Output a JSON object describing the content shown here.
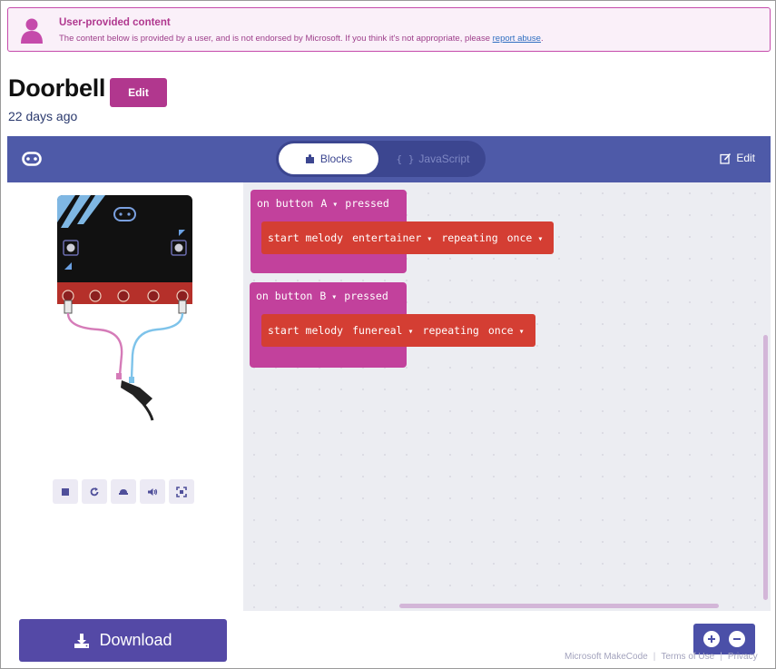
{
  "notice": {
    "title": "User-provided content",
    "body": "The content below is provided by a user, and is not endorsed by Microsoft. If you think it's not appropriate, please ",
    "link": "report abuse",
    "end": "."
  },
  "project": {
    "title": "Doorbell",
    "edit_label": "Edit",
    "subtitle": "22 days ago"
  },
  "editor_bar": {
    "tabs": [
      {
        "label": "Blocks",
        "active": true
      },
      {
        "label": "JavaScript",
        "active": false
      }
    ],
    "edit_label": "Edit"
  },
  "blocks": [
    {
      "event": {
        "prefix": "on button",
        "button": "A",
        "suffix": "pressed"
      },
      "statement": {
        "keyword": "start melody",
        "melody": "entertainer",
        "repeat_label": "repeating",
        "repeat_value": "once"
      }
    },
    {
      "event": {
        "prefix": "on button",
        "button": "B",
        "suffix": "pressed"
      },
      "statement": {
        "keyword": "start melody",
        "melody": "funereal",
        "repeat_label": "repeating",
        "repeat_value": "once"
      }
    }
  ],
  "simulator_controls": [
    "stop-icon",
    "restart-icon",
    "slow-motion-icon",
    "mute-icon",
    "fullscreen-icon"
  ],
  "download_label": "Download",
  "footer": {
    "brand": "Microsoft MakeCode",
    "terms": "Terms of Use",
    "privacy": "Privacy"
  },
  "colors": {
    "accent": "#b1378e",
    "toolbar": "#4e5aa8",
    "event_block": "#c2419c",
    "music_block": "#d43e33",
    "download": "#5449a6"
  }
}
